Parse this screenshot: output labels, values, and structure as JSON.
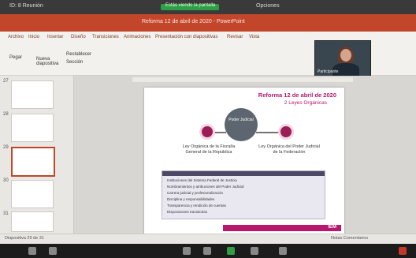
{
  "meeting_bar": {
    "left_label": "ID: 8 Reunión",
    "center_label": "Estás viendo la pantalla",
    "right_label": "Opciones"
  },
  "window_title": "Reforma 12 de abril de 2020 - PowerPoint",
  "ribbon": {
    "tabs": [
      "Archivo",
      "Inicio",
      "Insertar",
      "Diseño",
      "Transiciones",
      "Animaciones",
      "Presentación con diapositivas",
      "Revisar",
      "Vista"
    ],
    "items": [
      "Pegar",
      "Nueva diapositiva",
      "Restablecer",
      "Sección"
    ]
  },
  "video": {
    "caption": "Participante"
  },
  "thumbnails": {
    "numbers": [
      "27",
      "28",
      "29",
      "30",
      "31"
    ]
  },
  "slide": {
    "title": "Reforma 12 de abril de 2020",
    "subtitle": "2 Leyes Orgánicas",
    "center_label": "Poder Judicial",
    "left_caption": "Ley Orgánica de la Fiscalía General de la República",
    "right_caption": "Ley Orgánica del Poder Judicial de la Federación",
    "bullets": [
      "Instituciones del Sistema Federal de Justicia",
      "Nombramientos y atribuciones del Poder Judicial",
      "Carrera judicial y profesionalización",
      "Disciplina y responsabilidades",
      "Transparencia y rendición de cuentas",
      "Disposiciones transitorias"
    ],
    "logo": "IEM"
  },
  "status": {
    "left": "Diapositiva 29 de 31",
    "right": "Notas   Comentarios"
  }
}
